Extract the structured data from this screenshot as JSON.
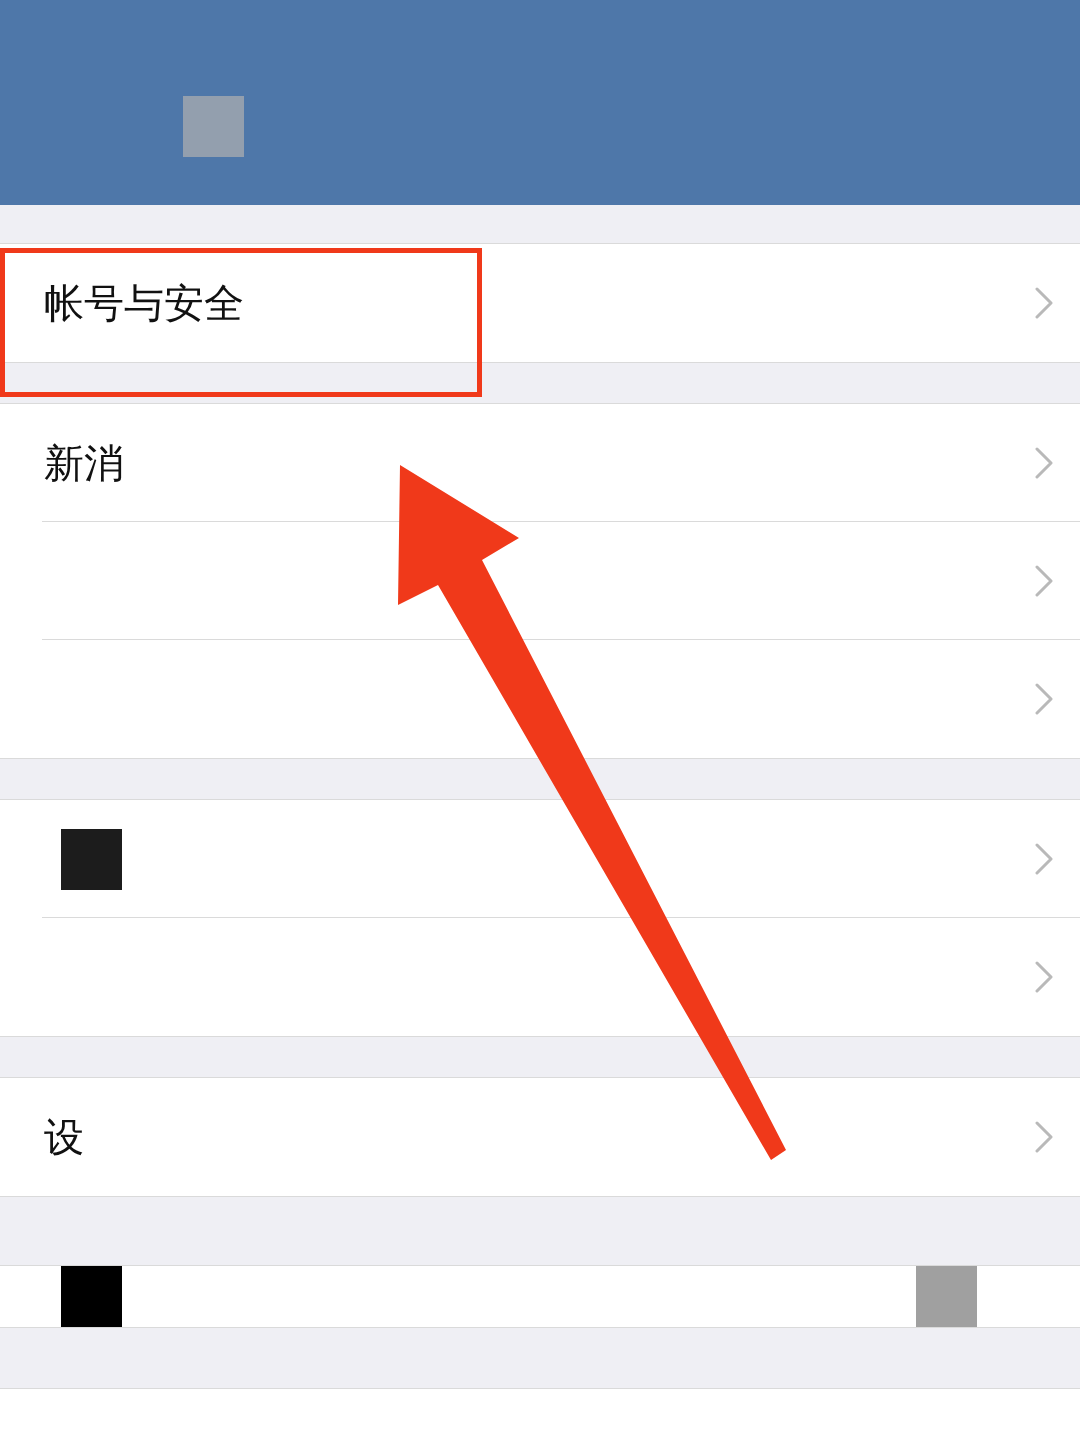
{
  "groups": [
    {
      "items": [
        {
          "kind": "link",
          "label": "帐号与安全",
          "highlighted": true,
          "masked": false
        }
      ]
    },
    {
      "items": [
        {
          "kind": "link",
          "label": "新消",
          "highlighted": false,
          "masked": false
        },
        {
          "kind": "link",
          "highlighted": false,
          "masked": false
        },
        {
          "kind": "link",
          "highlighted": false,
          "masked": false
        }
      ]
    },
    {
      "items": [
        {
          "kind": "link",
          "highlighted": false,
          "masked": true
        },
        {
          "kind": "link",
          "highlighted": false,
          "masked": false
        }
      ]
    },
    {
      "items": [
        {
          "kind": "link",
          "label": "设",
          "highlighted": false,
          "masked": false
        }
      ]
    },
    {
      "items": [
        {
          "kind": "strip",
          "highlighted": false,
          "masked": true
        }
      ]
    }
  ]
}
